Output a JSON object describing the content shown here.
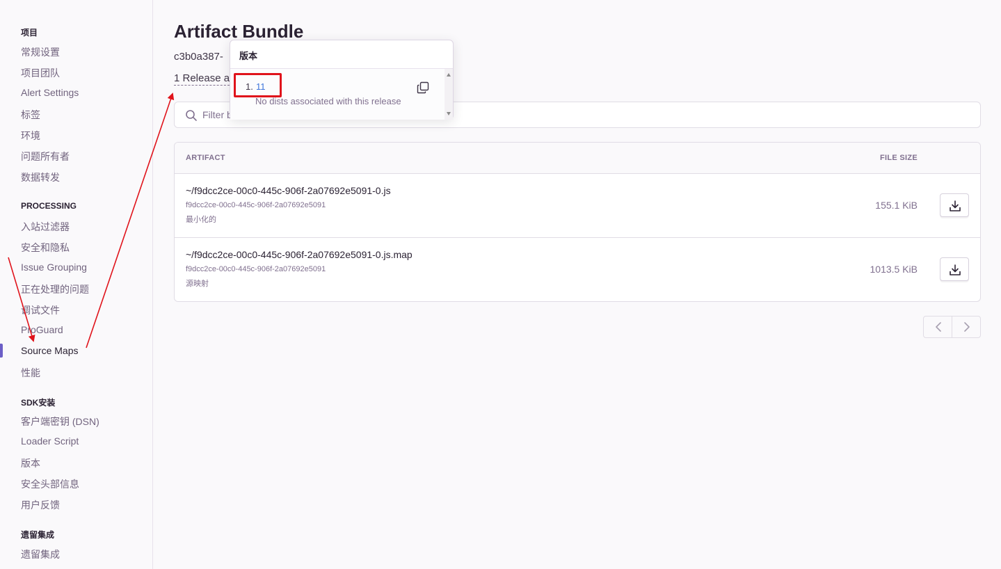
{
  "sidebar": {
    "sections": [
      {
        "title": "项目",
        "items": [
          "常规设置",
          "项目团队",
          "Alert Settings",
          "标签",
          "环境",
          "问题所有者",
          "数据转发"
        ]
      },
      {
        "title": "PROCESSING",
        "items": [
          "入站过滤器",
          "安全和隐私",
          "Issue Grouping",
          "正在处理的问题",
          "调试文件",
          "ProGuard",
          "Source Maps",
          "性能"
        ]
      },
      {
        "title": "SDK安装",
        "items": [
          "客户端密钥 (DSN)",
          "Loader Script",
          "版本",
          "安全头部信息",
          "用户反馈"
        ]
      },
      {
        "title": "遗留集成",
        "items": [
          "遗留集成"
        ]
      }
    ],
    "active_item": "Source Maps"
  },
  "main": {
    "title": "Artifact Bundle",
    "bundle_id": "c3b0a387-",
    "release_link": "1 Release",
    "release_link_suffix": "a",
    "search": {
      "placeholder": "Filter b"
    },
    "table": {
      "columns": [
        "ARTIFACT",
        "FILE SIZE"
      ],
      "rows": [
        {
          "name": "~/f9dcc2ce-00c0-445c-906f-2a07692e5091-0.js",
          "hash": "f9dcc2ce-00c0-445c-906f-2a07692e5091",
          "type": "最小化的",
          "size": "155.1 KiB"
        },
        {
          "name": "~/f9dcc2ce-00c0-445c-906f-2a07692e5091-0.js.map",
          "hash": "f9dcc2ce-00c0-445c-906f-2a07692e5091",
          "type": "源映射",
          "size": "1013.5 KiB"
        }
      ]
    }
  },
  "popover": {
    "title": "版本",
    "items": [
      {
        "index": "1.",
        "version": "11",
        "note": "No dists associated with this release"
      }
    ]
  },
  "colors": {
    "accent": "#6c5fc7",
    "link": "#3d74db",
    "annotation": "#e0131b"
  },
  "icons": [
    "search-icon",
    "download-icon",
    "copy-icon",
    "chevron-left-icon",
    "chevron-right-icon"
  ]
}
